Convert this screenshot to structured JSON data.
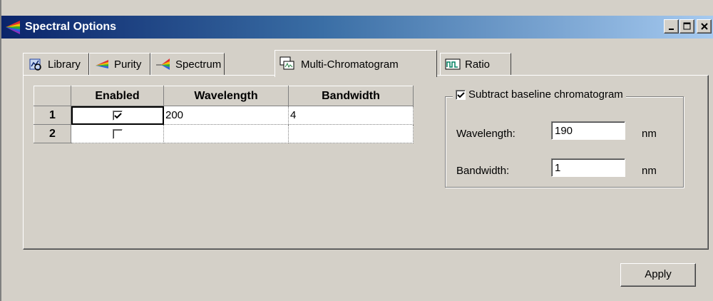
{
  "window": {
    "title": "Spectral Options",
    "icon": "spectrum-wedge-icon"
  },
  "title_buttons": {
    "minimize": "_",
    "maximize": "□",
    "close": "X"
  },
  "tabs": [
    {
      "label": "Library",
      "icon": "library-icon"
    },
    {
      "label": "Purity",
      "icon": "purity-wedge-icon"
    },
    {
      "label": "Spectrum",
      "icon": "spectrum-icon"
    },
    {
      "label": "Multi-Chromatogram",
      "icon": "multi-chromatogram-icon",
      "active": true
    },
    {
      "label": "Ratio",
      "icon": "ratio-icon"
    }
  ],
  "grid": {
    "columns": [
      "Enabled",
      "Wavelength",
      "Bandwidth"
    ],
    "rows": [
      {
        "index": "1",
        "enabled": true,
        "wavelength": "200",
        "bandwidth": "4"
      },
      {
        "index": "2",
        "enabled": false,
        "wavelength": "",
        "bandwidth": ""
      }
    ]
  },
  "baseline": {
    "checkbox_label": "Subtract baseline chromatogram",
    "checked": true,
    "wavelength_label": "Wavelength:",
    "wavelength_value": "190",
    "wavelength_unit": "nm",
    "bandwidth_label": "Bandwidth:",
    "bandwidth_value": "1",
    "bandwidth_unit": "nm"
  },
  "apply_label": "Apply",
  "colors": {
    "titlebar_start": "#0a246a",
    "titlebar_end": "#a6caf0",
    "face": "#d4d0c8"
  }
}
